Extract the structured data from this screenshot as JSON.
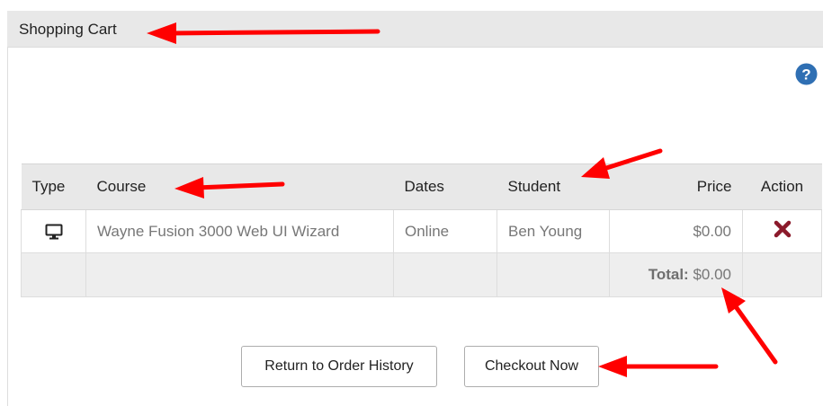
{
  "panel": {
    "title": "Shopping Cart"
  },
  "help": {
    "icon": "question-circle-icon"
  },
  "table": {
    "columns": {
      "type": "Type",
      "course": "Course",
      "dates": "Dates",
      "student": "Student",
      "price": "Price",
      "action": "Action"
    },
    "rows": [
      {
        "type_icon": "monitor-icon",
        "course": "Wayne Fusion 3000 Web UI Wizard",
        "dates": "Online",
        "student": "Ben Young",
        "price": "$0.00",
        "action_icon": "remove-x-icon"
      }
    ],
    "total": {
      "label": "Total:",
      "value": "$0.00"
    }
  },
  "buttons": {
    "return_label": "Return to Order History",
    "checkout_label": "Checkout Now"
  },
  "colors": {
    "help_icon": "#2f6fb3",
    "remove_icon": "#8b1a2b",
    "annotation_arrow": "#ff0000"
  }
}
